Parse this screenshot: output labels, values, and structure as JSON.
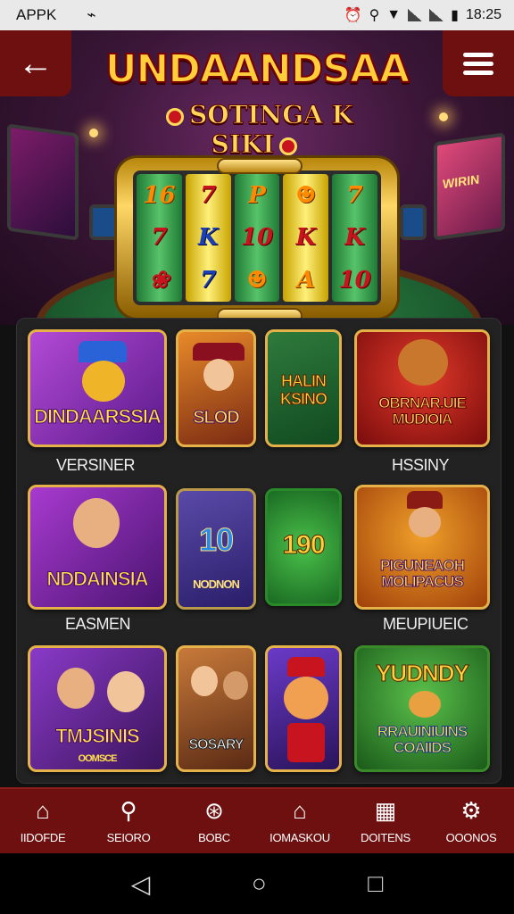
{
  "status": {
    "app": "APPK",
    "time": "18:25",
    "battery": "▮"
  },
  "header": {
    "back_icon": "back-arrow-icon",
    "menu_icon": "hamburger-menu-icon",
    "title": "UNDAANDSAA",
    "subtitle": "SOTINGA K SIKI"
  },
  "hero_extra": {
    "screen_text": "WIRIN"
  },
  "reels": [
    [
      "16",
      "7",
      "❀"
    ],
    [
      "7",
      "K",
      "7"
    ],
    [
      "P",
      "10",
      "☻"
    ],
    [
      "☻",
      "K",
      "A"
    ],
    [
      "7",
      "K",
      "10"
    ]
  ],
  "tiles": [
    {
      "label": "DINDAARSSIA"
    },
    {
      "label": "SLOD"
    },
    {
      "label": "HALIN KSINO"
    },
    {
      "label": "OBRNAR.UIE MUDIOIA"
    },
    {
      "label": "NDDAINSIA"
    },
    {
      "label": "10",
      "sub": "NODNON"
    },
    {
      "label": "190"
    },
    {
      "label": "PIGUNEAOH MOLIPACUS"
    },
    {
      "label": "TMJSINIS",
      "sub": "OOMSCE"
    },
    {
      "label": "SOSARY"
    },
    {
      "label": ""
    },
    {
      "label": "YUDNDY",
      "sub": "RRAUINIUINS COAIIDS"
    }
  ],
  "captions": {
    "c1": "VERSINER",
    "c2": "HSSINY",
    "c3": "EASMEN",
    "c4": "MEUPIUEIC"
  },
  "nav": [
    {
      "label": "IIDOFDE",
      "icon": "home-icon"
    },
    {
      "label": "SEIORO",
      "icon": "search-icon"
    },
    {
      "label": "BOBC",
      "icon": "chip-icon"
    },
    {
      "label": "IOMASKOU",
      "icon": "house-flag-icon"
    },
    {
      "label": "DOITENS",
      "icon": "calendar-icon"
    },
    {
      "label": "OOONOS",
      "icon": "gear-icon"
    }
  ]
}
